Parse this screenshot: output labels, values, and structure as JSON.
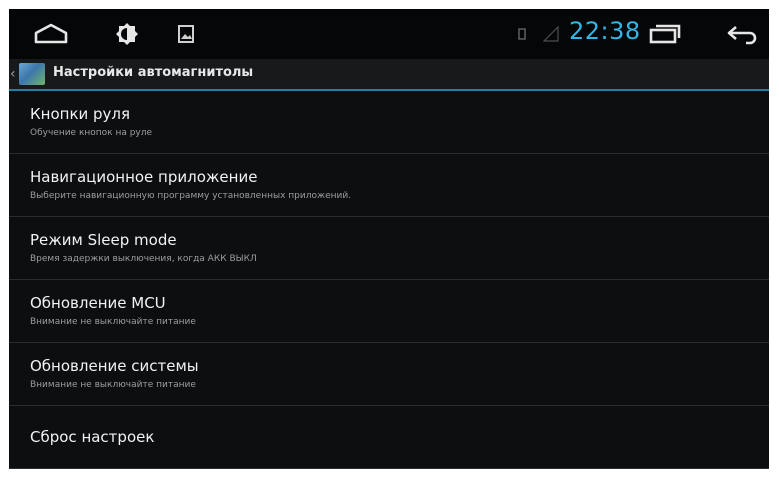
{
  "status_bar": {
    "time": "22:38",
    "icons": [
      "home-icon",
      "brightness-icon",
      "gallery-icon",
      "sim-icon",
      "signal-icon",
      "recent-apps-icon",
      "back-icon"
    ],
    "accent_color": "#33b5e5"
  },
  "action_bar": {
    "title": "Настройки автомагнитолы",
    "icon": "car-settings-app-icon"
  },
  "settings": [
    {
      "title": "Кнопки руля",
      "summary": "Обучение кнопок на руле"
    },
    {
      "title": "Навигационное приложение",
      "summary": "Выберите навигационную программу установленных приложений."
    },
    {
      "title": "Режим Sleep mode",
      "summary": "Время задержки выключения, когда АКК ВЫКЛ"
    },
    {
      "title": "Обновление MCU",
      "summary": "Внимание не выключайте питание"
    },
    {
      "title": "Обновление системы",
      "summary": "Внимание не выключайте питание"
    },
    {
      "title": "Сброс настроек",
      "summary": ""
    }
  ]
}
